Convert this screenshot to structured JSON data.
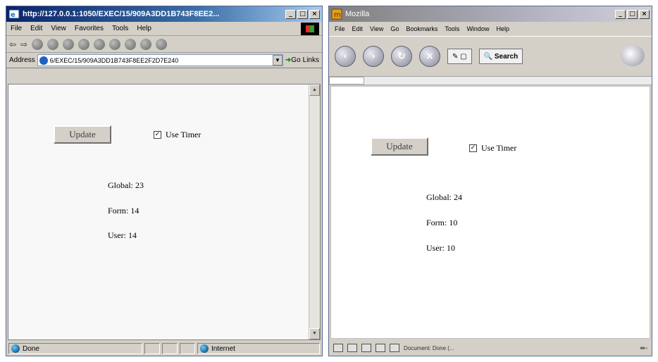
{
  "ie": {
    "title": "http://127.0.0.1:1050/EXEC/15/909A3DD1B743F8EE2...",
    "menu": [
      "File",
      "Edit",
      "View",
      "Favorites",
      "Tools",
      "Help"
    ],
    "address_label": "Address",
    "address_value": "6/EXEC/15/909A3DD1B743F8EE2F2D7E240",
    "go_label": "Go",
    "links_label": "Links",
    "status_text": "Done",
    "zone_text": "Internet",
    "update_label": "Update",
    "timer_label": "Use Timer",
    "timer_checked": "✓",
    "global_text": "Global: 23",
    "form_text": "Form: 14",
    "user_text": "User: 14"
  },
  "moz": {
    "title": "Mozilla",
    "menu": [
      "File",
      "Edit",
      "View",
      "Go",
      "Bookmarks",
      "Tools",
      "Window",
      "Help"
    ],
    "search_label": "Search",
    "update_label": "Update",
    "timer_label": "Use Timer",
    "timer_checked": "✓",
    "global_text": "Global: 24",
    "form_text": "Form: 10",
    "user_text": "User: 10",
    "status_text": "Document: Done (..."
  }
}
